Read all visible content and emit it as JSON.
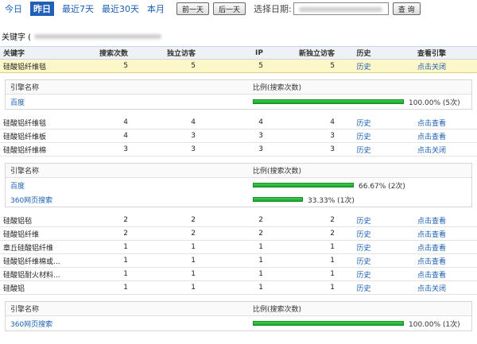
{
  "toolbar": {
    "ranges": [
      "今日",
      "昨日",
      "最近7天",
      "最近30天",
      "本月"
    ],
    "active_range": "昨日",
    "prev_day": "前一天",
    "next_day": "后一天",
    "date_label": "选择日期:",
    "query": "查 询"
  },
  "section_title": "关键字 (",
  "columns": [
    "关键字",
    "搜索次数",
    "独立访客",
    "IP",
    "新独立访客",
    "历史",
    "查看引擎"
  ],
  "engine_columns": [
    "引擎名称",
    "比例(搜索次数)"
  ],
  "history_label": "历史",
  "rows": [
    {
      "keyword": "硅酸铝纤维毯",
      "searches": "5",
      "visitors": "5",
      "ip": "5",
      "new_visitors": "5",
      "history": "历史",
      "action": "点击关闭",
      "highlight": true
    },
    {
      "keyword": "硅酸铝纤维毯",
      "searches": "4",
      "visitors": "4",
      "ip": "4",
      "new_visitors": "4",
      "history": "历史",
      "action": "点击查看"
    },
    {
      "keyword": "硅酸铝纤维板",
      "searches": "4",
      "visitors": "3",
      "ip": "3",
      "new_visitors": "3",
      "history": "历史",
      "action": "点击查看"
    },
    {
      "keyword": "硅酸铝纤维棉",
      "searches": "3",
      "visitors": "3",
      "ip": "3",
      "new_visitors": "3",
      "history": "历史",
      "action": "点击关闭"
    },
    {
      "keyword": "硅酸铝毡",
      "searches": "2",
      "visitors": "2",
      "ip": "2",
      "new_visitors": "2",
      "history": "历史",
      "action": "点击查看"
    },
    {
      "keyword": "硅酸铝纤维",
      "searches": "2",
      "visitors": "2",
      "ip": "2",
      "new_visitors": "2",
      "history": "历史",
      "action": "点击查看"
    },
    {
      "keyword": "章丘硅酸铝纤维",
      "searches": "1",
      "visitors": "1",
      "ip": "1",
      "new_visitors": "1",
      "history": "历史",
      "action": "点击查看"
    },
    {
      "keyword": "硅酸铝纤维棉或...",
      "searches": "1",
      "visitors": "1",
      "ip": "1",
      "new_visitors": "1",
      "history": "历史",
      "action": "点击查看"
    },
    {
      "keyword": "硅酸铝耐火材料...",
      "searches": "1",
      "visitors": "1",
      "ip": "1",
      "new_visitors": "1",
      "history": "历史",
      "action": "点击查看"
    },
    {
      "keyword": "硅酸铝",
      "searches": "1",
      "visitors": "1",
      "ip": "1",
      "new_visitors": "1",
      "history": "历史",
      "action": "点击关闭"
    }
  ],
  "engines_1": [
    {
      "name": "百度",
      "fraction": 1.0,
      "label": "100.00% (5次)"
    }
  ],
  "engines_2": [
    {
      "name": "百度",
      "fraction": 0.6667,
      "label": "66.67% (2次)"
    },
    {
      "name": "360网页搜索",
      "fraction": 0.3333,
      "label": "33.33% (1次)"
    }
  ],
  "engines_3": [
    {
      "name": "360网页搜索",
      "fraction": 1.0,
      "label": "100.00% (1次)"
    }
  ],
  "colors": {
    "accent": "#1a5fb4",
    "bar": "#22b234",
    "highlight": "#fdf6c8"
  }
}
